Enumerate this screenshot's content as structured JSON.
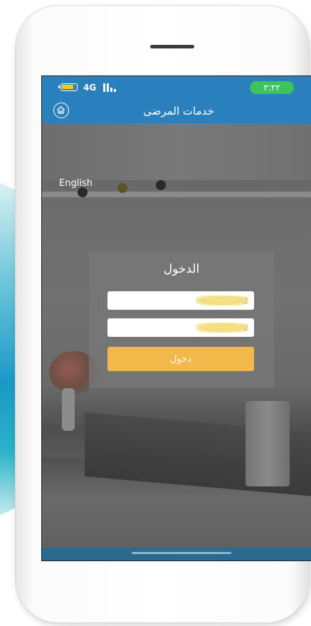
{
  "status_bar": {
    "network": "4G",
    "time": "٣:٢٢",
    "battery_color": "#f5d000",
    "time_badge_color": "#3cc45a"
  },
  "app_bar": {
    "title": "خدمات المرضى",
    "home_icon": "home-icon",
    "color": "#2a7fbd"
  },
  "language_link": "English",
  "login": {
    "title": "الدخول",
    "username_value": "152765*2",
    "password_value": "4454*2",
    "submit_label": "دخول",
    "submit_color": "#f2b84a"
  }
}
